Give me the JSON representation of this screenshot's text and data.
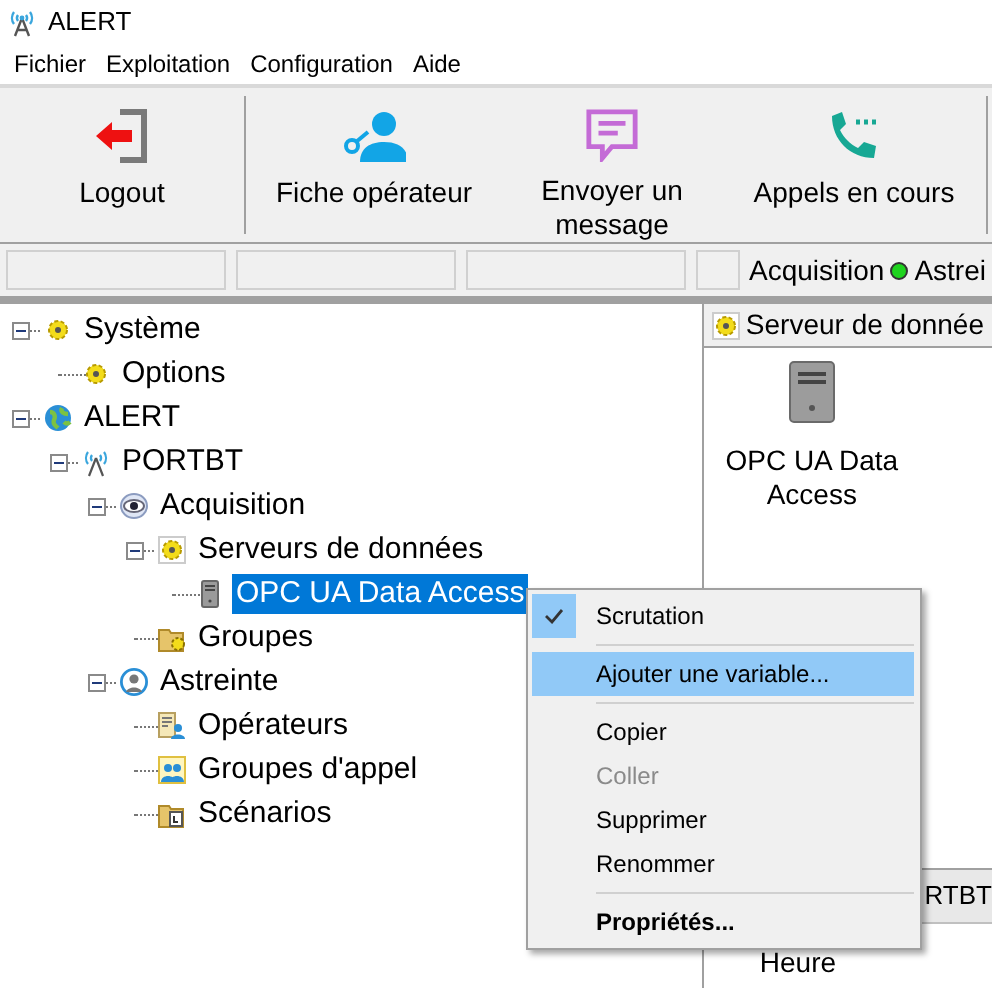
{
  "window": {
    "title": "ALERT"
  },
  "menu": [
    "Fichier",
    "Exploitation",
    "Configuration",
    "Aide"
  ],
  "toolbar": [
    {
      "label": "Logout"
    },
    {
      "label": "Fiche opérateur"
    },
    {
      "label": "Envoyer un message"
    },
    {
      "label": "Appels en cours"
    }
  ],
  "status_bar": [
    {
      "label": "Acquisition",
      "color": "#1ed31e"
    },
    {
      "label": "Astrei"
    }
  ],
  "tree": [
    {
      "label": "Système",
      "expanded": true,
      "selected": false,
      "children": [
        {
          "label": "Options",
          "selected": false
        }
      ]
    },
    {
      "label": "ALERT",
      "expanded": true,
      "selected": false,
      "children": [
        {
          "label": "PORTBT",
          "expanded": true,
          "selected": false,
          "children": [
            {
              "label": "Acquisition",
              "expanded": true,
              "selected": false,
              "children": [
                {
                  "label": "Serveurs de données",
                  "expanded": true,
                  "selected": false,
                  "children": [
                    {
                      "label": "OPC UA Data Access",
                      "selected": true
                    }
                  ]
                },
                {
                  "label": "Groupes",
                  "selected": false
                }
              ]
            },
            {
              "label": "Astreinte",
              "expanded": true,
              "selected": false,
              "children": [
                {
                  "label": "Opérateurs",
                  "selected": false
                },
                {
                  "label": "Groupes d'appel",
                  "selected": false
                },
                {
                  "label": "Scénarios",
                  "selected": false
                }
              ]
            }
          ]
        }
      ]
    }
  ],
  "details": {
    "header": "Serveur de donnée",
    "items": [
      {
        "label": "OPC UA Data Access"
      }
    ],
    "tab": "RTBT",
    "column": "Heure"
  },
  "context_menu": [
    {
      "kind": "item",
      "label": "Scrutation",
      "checked": true,
      "selected": false,
      "disabled": false,
      "default": false
    },
    {
      "kind": "separator"
    },
    {
      "kind": "item",
      "label": "Ajouter une variable...",
      "checked": false,
      "selected": true,
      "disabled": false,
      "default": false
    },
    {
      "kind": "separator"
    },
    {
      "kind": "item",
      "label": "Copier",
      "checked": false,
      "selected": false,
      "disabled": false,
      "default": false
    },
    {
      "kind": "item",
      "label": "Coller",
      "checked": false,
      "selected": false,
      "disabled": true,
      "default": false
    },
    {
      "kind": "item",
      "label": "Supprimer",
      "checked": false,
      "selected": false,
      "disabled": false,
      "default": false
    },
    {
      "kind": "item",
      "label": "Renommer",
      "checked": false,
      "selected": false,
      "disabled": false,
      "default": false
    },
    {
      "kind": "separator"
    },
    {
      "kind": "item",
      "label": "Propriétés...",
      "checked": false,
      "selected": false,
      "disabled": false,
      "default": true
    }
  ]
}
